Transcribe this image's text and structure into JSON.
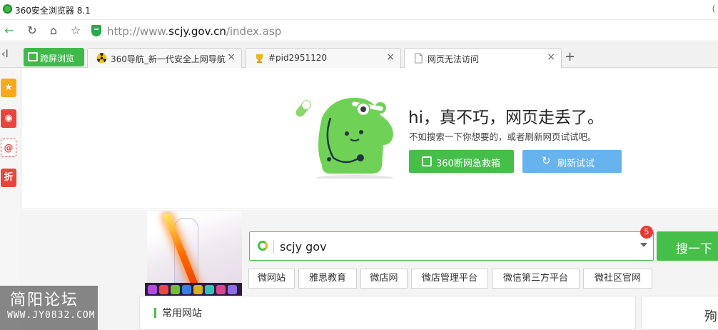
{
  "window": {
    "title": "360安全浏览器 8.1",
    "right_glyph": "⟨"
  },
  "address_bar": {
    "back": "←",
    "reload": "↻",
    "home": "⌂",
    "favorite": "☆",
    "url_prefix": "http://www.",
    "url_domain": "scjy.gov.cn",
    "url_path": "/index.asp"
  },
  "tabs": {
    "nav_arrow": "‹I",
    "split_view": "跨屏浏览",
    "items": [
      {
        "label": "360导航_新一代安全上网导航",
        "close": "×"
      },
      {
        "label": "#pid2951120",
        "close": "×"
      },
      {
        "label": "网页无法访问",
        "close": "×",
        "active": true
      }
    ],
    "new_tab": "+"
  },
  "sidebar": {
    "items": [
      {
        "icon": "star-icon",
        "glyph": "★"
      },
      {
        "icon": "weibo-icon",
        "glyph": "◉"
      },
      {
        "icon": "mail-icon",
        "glyph": "@"
      },
      {
        "icon": "discount-icon",
        "glyph": "折"
      }
    ]
  },
  "error_page": {
    "headline": "hi，真不巧，网页走丢了。",
    "subtext": "不如搜索一下你想要的，或者刷新网页试试吧。",
    "rescue_button": "360断网急救箱",
    "refresh_button": "刷新试试",
    "refresh_glyph": "↻"
  },
  "search": {
    "query": "scjy gov",
    "badge": "5",
    "button": "搜一下"
  },
  "quick_links": [
    "微网站",
    "雅思教育",
    "微店网",
    "微店管理平台",
    "微信第三方平台",
    "微社区官网"
  ],
  "panel": {
    "title": "常用网站",
    "right_text": "殉"
  },
  "watermark": {
    "line1": "简阳论坛",
    "line2": "WWW.JY0832.COM"
  },
  "colors": {
    "green": "#45bf49",
    "blue": "#66b3ee",
    "badge": "#e53935"
  }
}
